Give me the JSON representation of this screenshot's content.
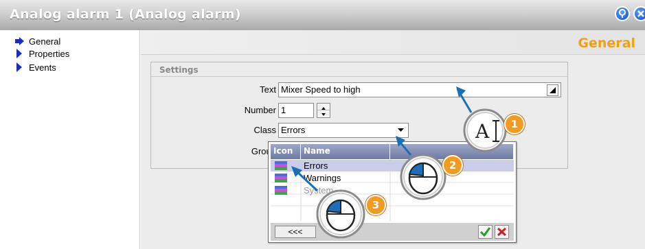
{
  "window": {
    "title": "Analog alarm 1 (Analog alarm)",
    "help_icon": "help-icon",
    "close_icon": "close-icon"
  },
  "sidebar": {
    "items": [
      {
        "label": "General",
        "icon": "arrow-right-icon",
        "selected": true
      },
      {
        "label": "Properties",
        "icon": "triangle-right-icon"
      },
      {
        "label": "Events",
        "icon": "triangle-right-icon"
      }
    ]
  },
  "section": {
    "title": "General",
    "group_title": "Settings"
  },
  "fields": {
    "text_label": "Text",
    "text_value": "Mixer Speed to high",
    "number_label": "Number",
    "number_value": "1",
    "class_label": "Class",
    "class_value": "Errors",
    "group_label": "Group"
  },
  "dropdown": {
    "col_icon": "Icon",
    "col_name": "Name",
    "rows": [
      {
        "name": "Errors",
        "selected": true
      },
      {
        "name": "Warnings"
      },
      {
        "name": "System"
      }
    ],
    "back_label": "<<<",
    "ok_icon": "checkmark-icon",
    "cancel_icon": "x-icon"
  },
  "callouts": [
    {
      "number": "1",
      "icon": "text-cursor-icon"
    },
    {
      "number": "2",
      "icon": "mouse-icon"
    },
    {
      "number": "3",
      "icon": "mouse-icon"
    }
  ],
  "colors": {
    "accent": "#f0a018",
    "badge": "#f39a20",
    "nav_arrow": "#1a2ac8",
    "selection": "#c9cde9"
  }
}
